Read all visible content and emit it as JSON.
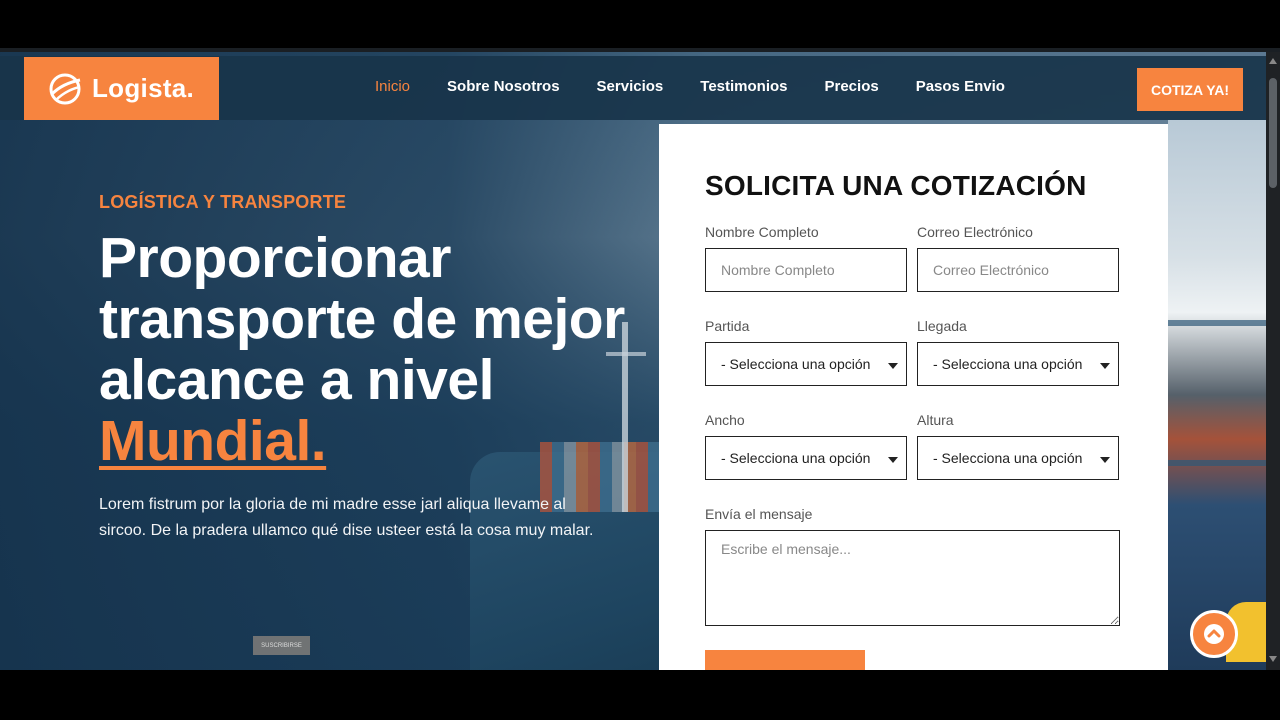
{
  "brand": {
    "name": "Logista.",
    "logo_icon": "globe-swoosh-icon",
    "accent": "#f7843f"
  },
  "nav": {
    "items": [
      {
        "label": "Inicio",
        "active": true
      },
      {
        "label": "Sobre Nosotros",
        "active": false
      },
      {
        "label": "Servicios",
        "active": false
      },
      {
        "label": "Testimonios",
        "active": false
      },
      {
        "label": "Precios",
        "active": false
      },
      {
        "label": "Pasos Envio",
        "active": false
      }
    ],
    "cta_label": "COTIZA YA!"
  },
  "hero": {
    "eyebrow": "LOGÍSTICA Y TRANSPORTE",
    "headline_main": "Proporcionar transporte de mejor alcance a nivel ",
    "headline_accent": "Mundial.",
    "lead": "Lorem fistrum por la gloria de mi madre esse jarl aliqua llevame al sircoo. De la pradera ullamco qué dise usteer está la cosa muy malar.",
    "chip_label": "SUSCRIBIRSE"
  },
  "quote_form": {
    "title": "SOLICITA UNA COTIZACIÓN",
    "name": {
      "label": "Nombre Completo",
      "placeholder": "Nombre Completo"
    },
    "email": {
      "label": "Correo Electrónico",
      "placeholder": "Correo Electrónico"
    },
    "origin": {
      "label": "Partida",
      "value": "- Selecciona una opción"
    },
    "destination": {
      "label": "Llegada",
      "value": "- Selecciona una opción"
    },
    "width": {
      "label": "Ancho",
      "value": "- Selecciona una opción"
    },
    "height": {
      "label": "Altura",
      "value": "- Selecciona una opción"
    },
    "message": {
      "label": "Envía el mensaje",
      "placeholder": "Escribe el mensaje..."
    }
  },
  "icons": {
    "scroll_top": "chevron-up-icon",
    "select_caret": "caret-down-icon"
  }
}
